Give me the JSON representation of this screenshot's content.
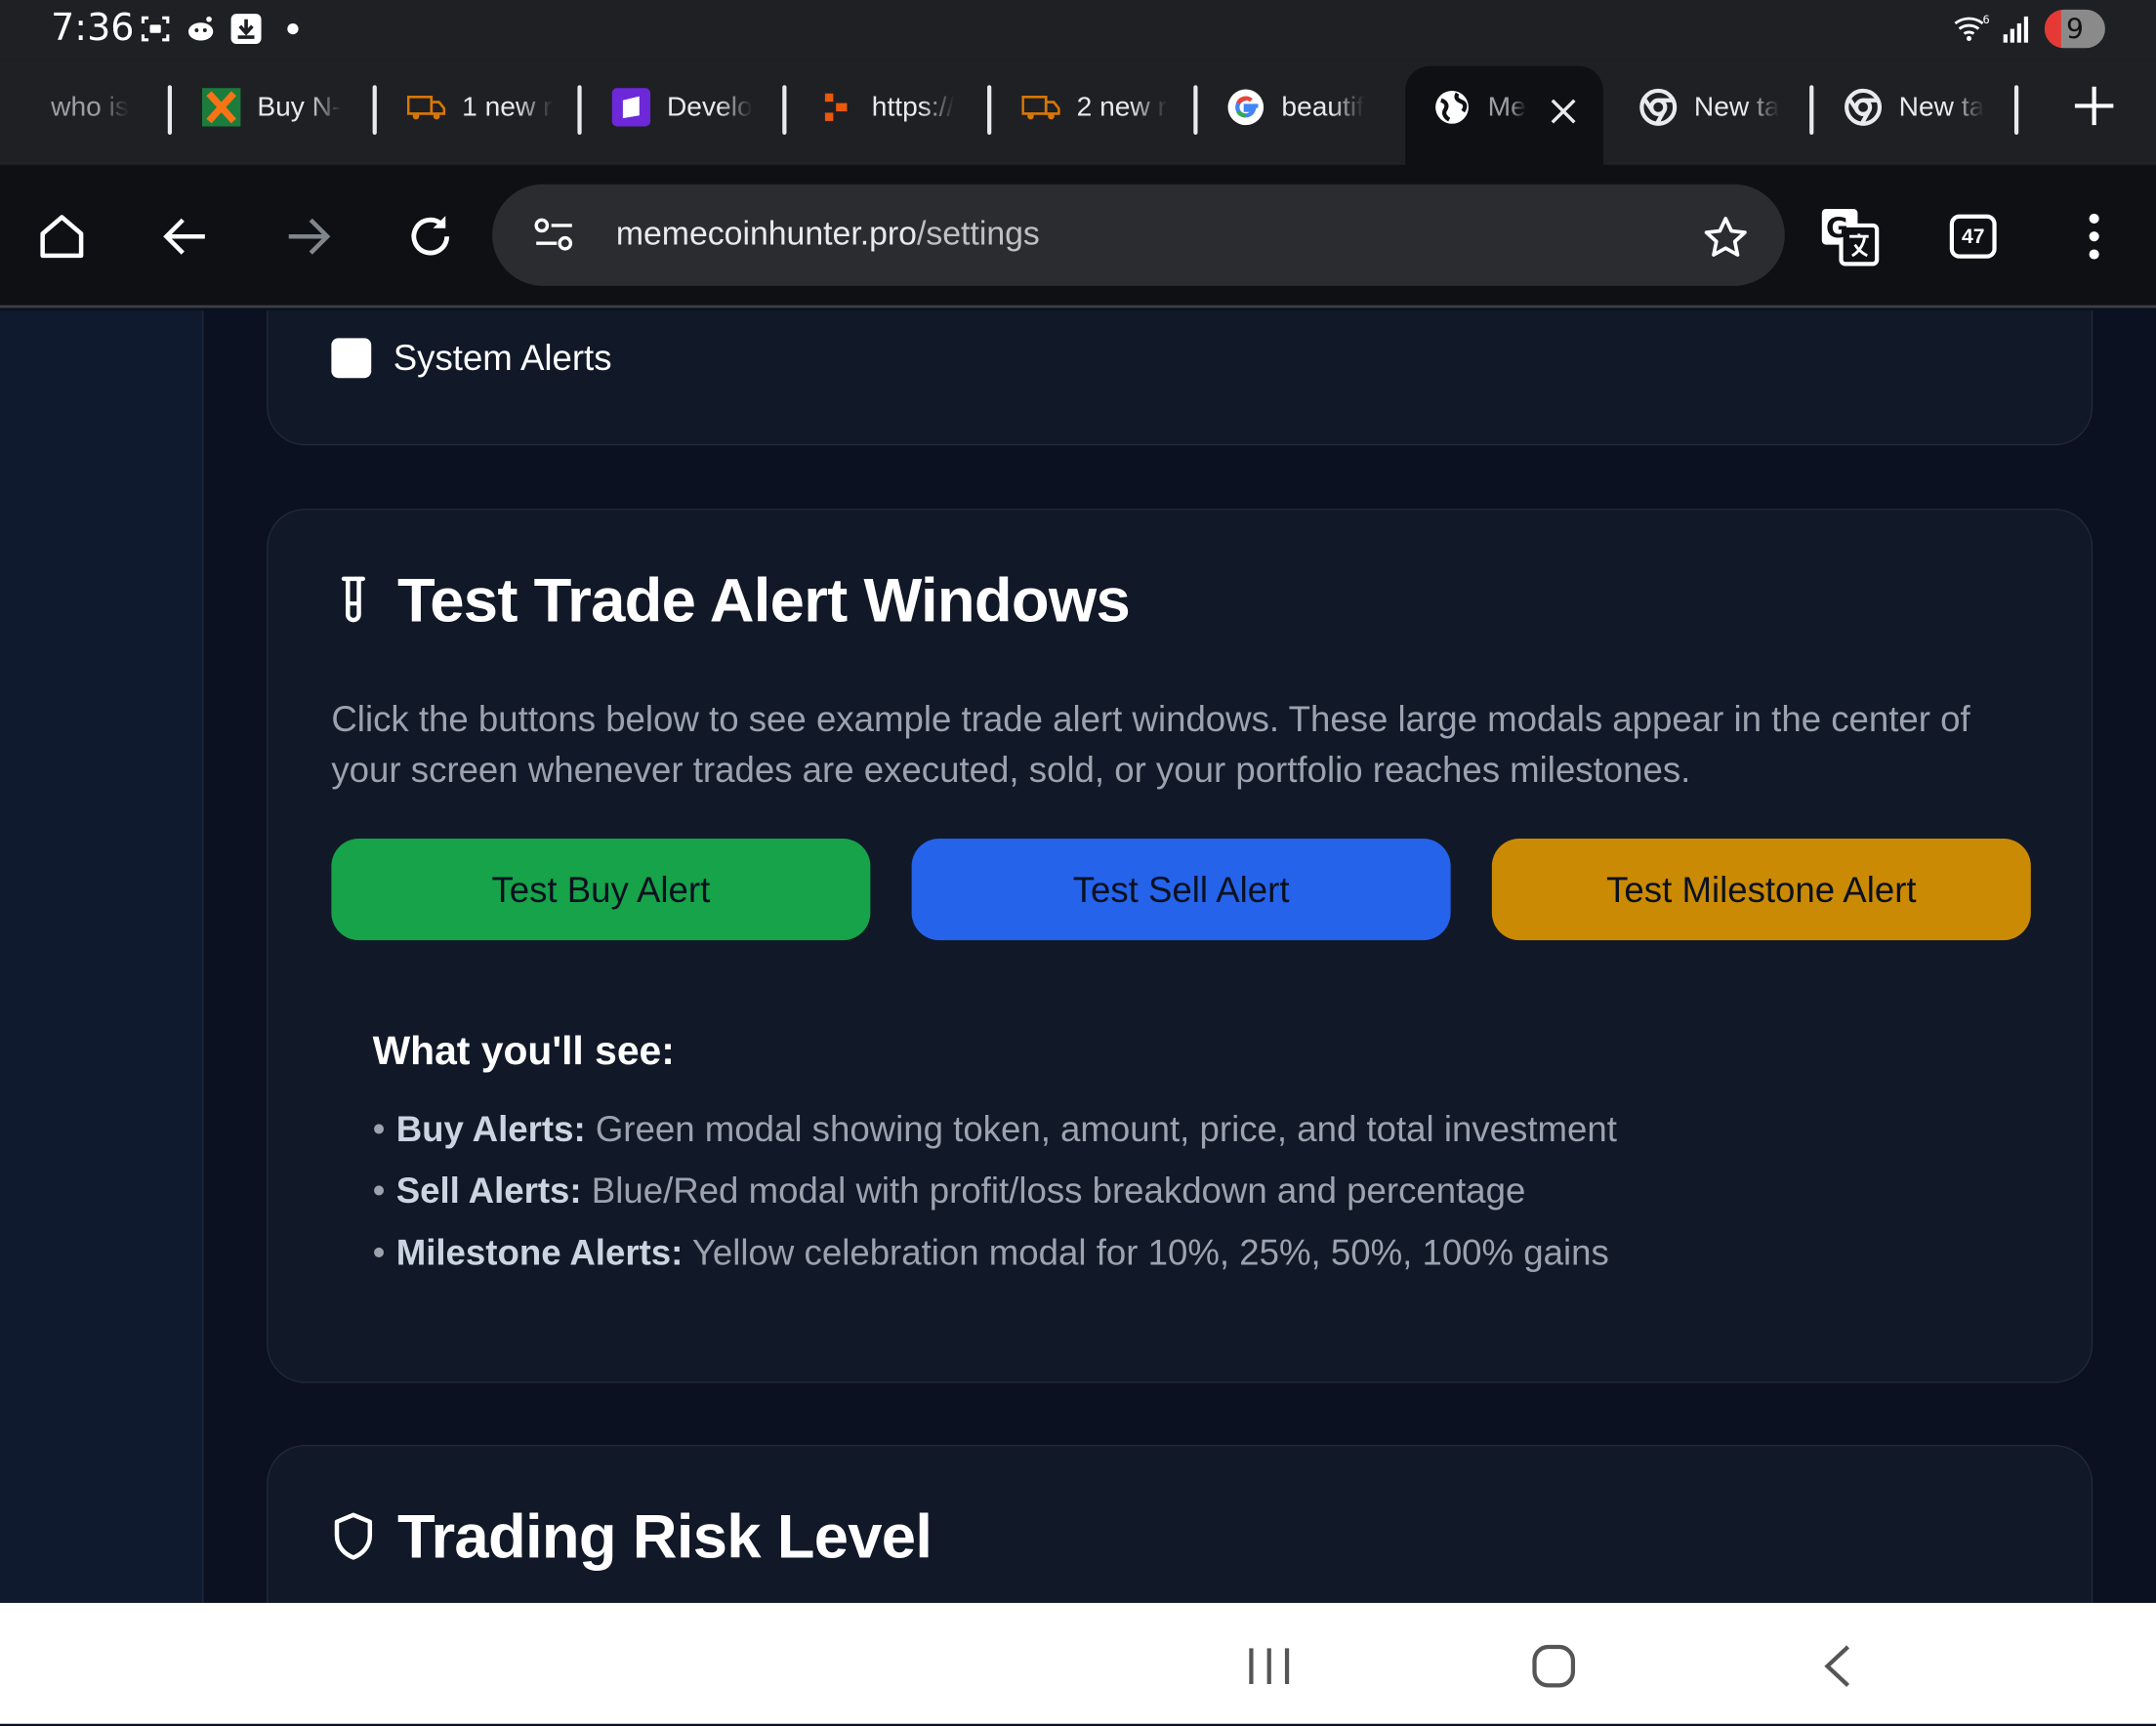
{
  "status_bar": {
    "time": "7:36",
    "wifi_badge": "6",
    "battery_level": "9",
    "icons": [
      "screenshot-icon",
      "reddit-icon",
      "download-icon",
      "wifi-icon",
      "signal-icon",
      "battery-icon"
    ]
  },
  "tabs": [
    {
      "label": "who is",
      "favicon": "none"
    },
    {
      "label": "Buy N-",
      "favicon": "x-logo-icon"
    },
    {
      "label": "1 new r",
      "favicon": "truck-icon"
    },
    {
      "label": "Develo",
      "favicon": "purple-square-icon"
    },
    {
      "label": "https://",
      "favicon": "orange-shape-icon"
    },
    {
      "label": "2 new r",
      "favicon": "truck-icon"
    },
    {
      "label": "beautif",
      "favicon": "google-icon"
    },
    {
      "label": "Me",
      "favicon": "globe-icon",
      "active": true
    },
    {
      "label": "New ta",
      "favicon": "chrome-icon"
    },
    {
      "label": "New ta",
      "favicon": "chrome-icon"
    }
  ],
  "toolbar": {
    "url_host": "memecoinhunter.pro",
    "url_path": "/settings",
    "tab_count": "47"
  },
  "card_notifications": {
    "checkbox_label": "System Alerts"
  },
  "card_test": {
    "title": "Test Trade Alert Windows",
    "description": "Click the buttons below to see example trade alert windows. These large modals appear in the center of your screen whenever trades are executed, sold, or your portfolio reaches milestones.",
    "buttons": {
      "buy": "Test Buy Alert",
      "sell": "Test Sell Alert",
      "milestone": "Test Milestone Alert"
    },
    "see_title": "What you'll see:",
    "items": [
      {
        "term": "Buy Alerts:",
        "text": " Green modal showing token, amount, price, and total investment"
      },
      {
        "term": "Sell Alerts:",
        "text": " Blue/Red modal with profit/loss breakdown and percentage"
      },
      {
        "term": "Milestone Alerts:",
        "text": " Yellow celebration modal for 10%, 25%, 50%, 100% gains"
      }
    ]
  },
  "card_risk": {
    "title": "Trading Risk Level"
  },
  "colors": {
    "buy": "#16a34a",
    "sell": "#2563eb",
    "milestone": "#ca8a04",
    "page_bg": "#0b1120",
    "card_bg": "#111827"
  }
}
